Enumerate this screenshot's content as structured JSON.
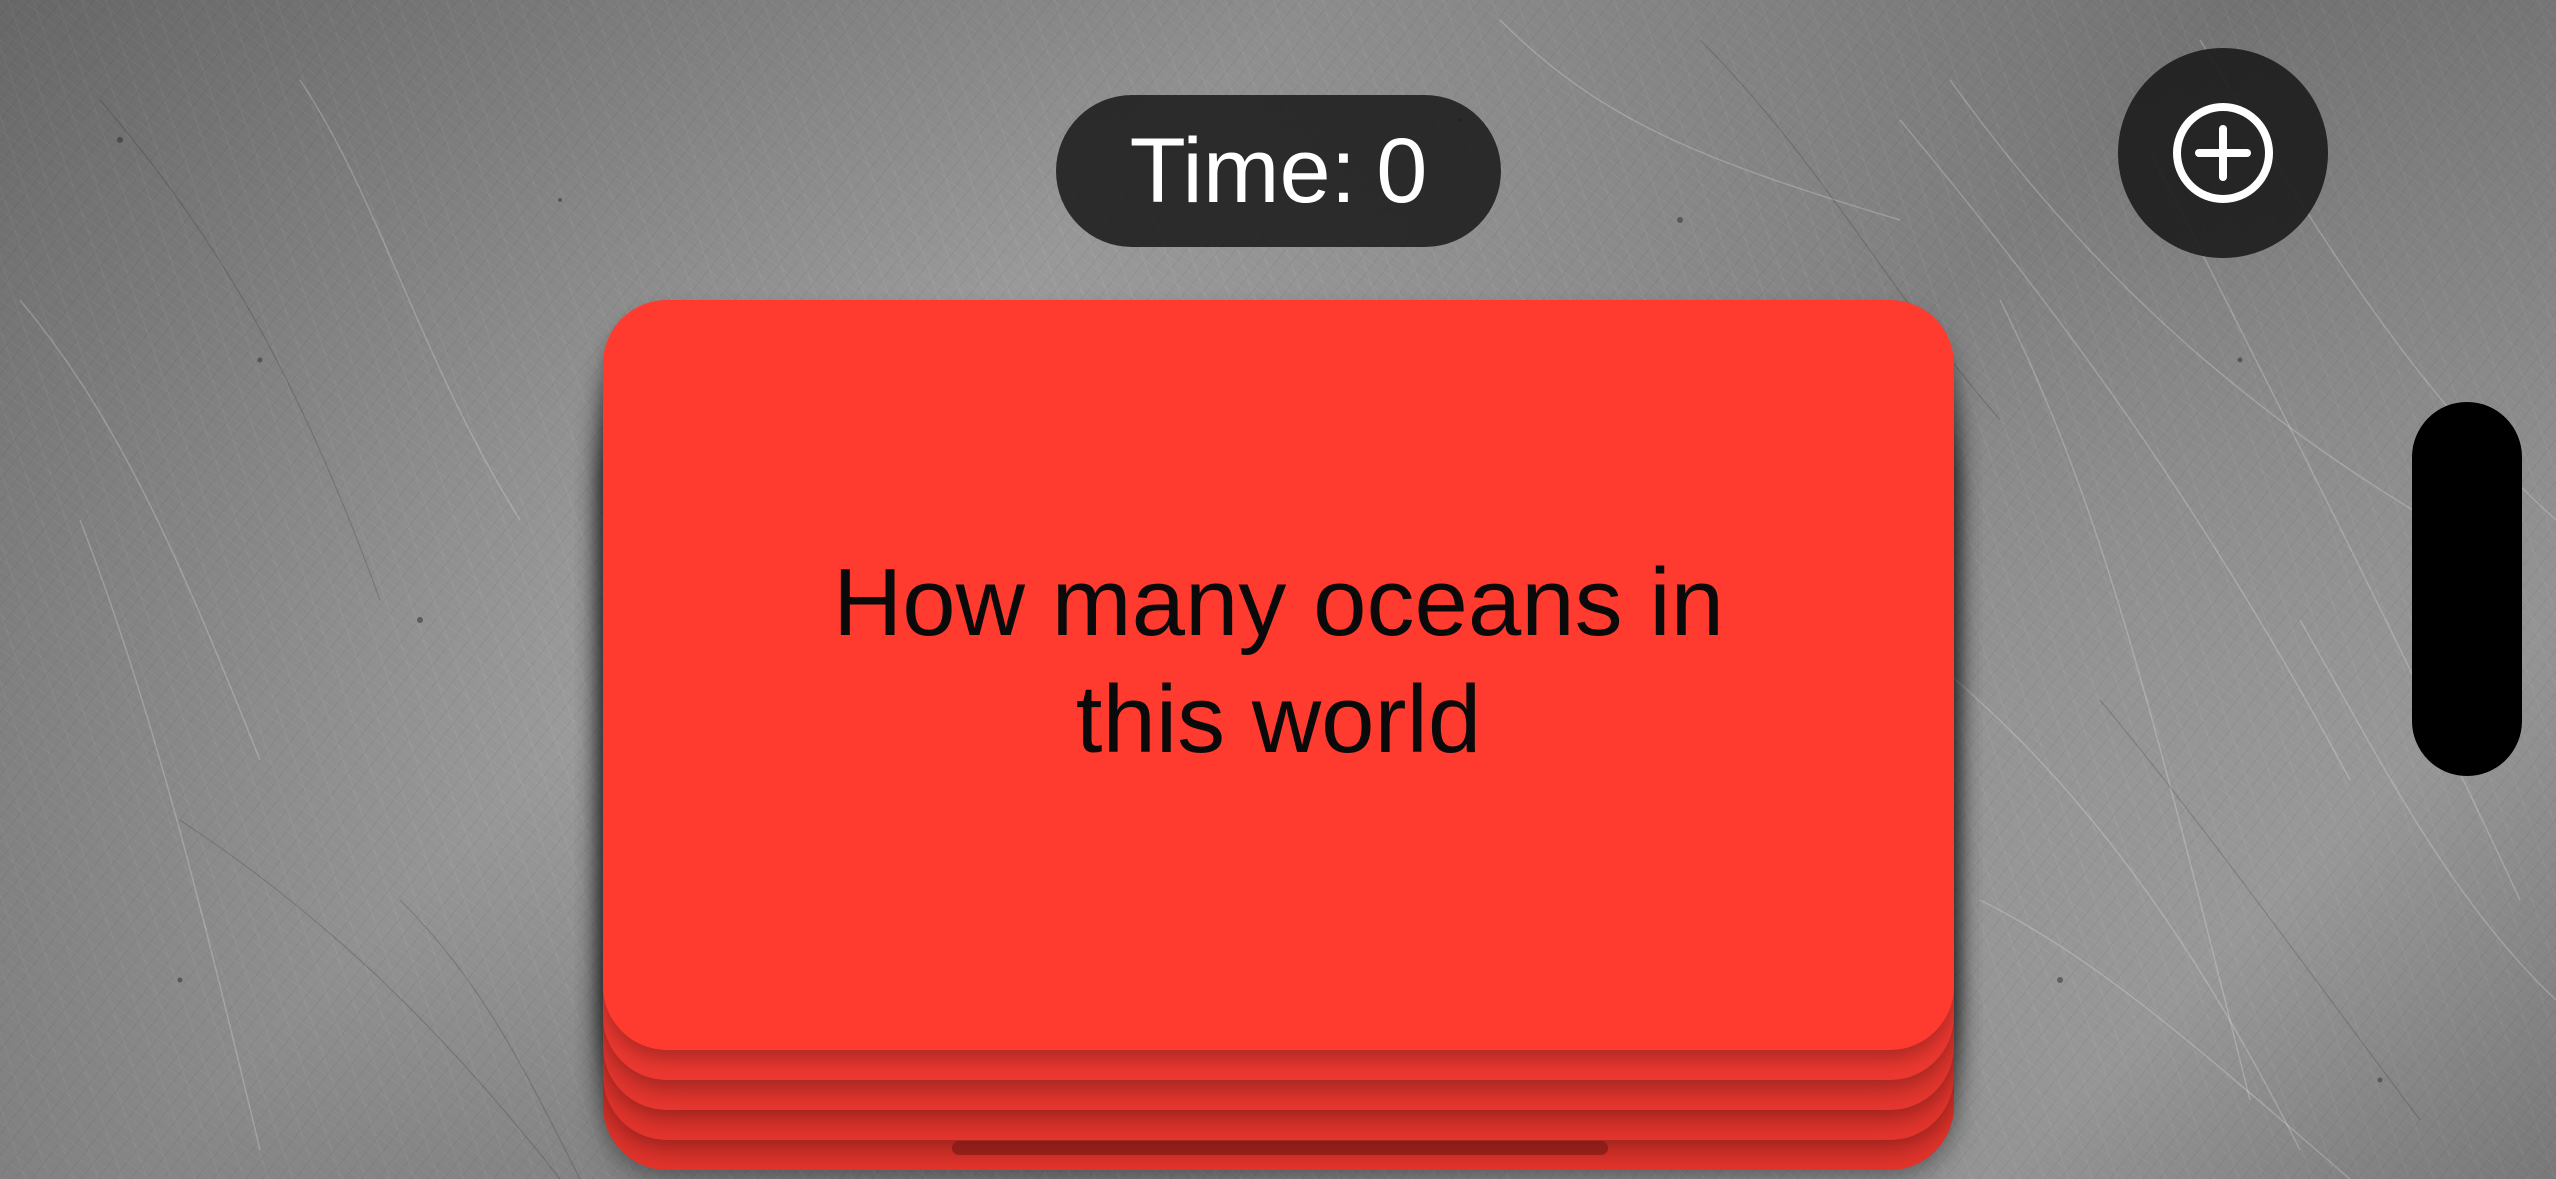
{
  "timer": {
    "label": "Time:",
    "value": "0"
  },
  "toolbar": {
    "add_icon": "plus-circle-icon"
  },
  "card": {
    "question": "How many oceans in this world",
    "color": "#ff3b30"
  },
  "colors": {
    "pill_background": "#1c1c1c",
    "card_red": "#ff3b30",
    "text_white": "#ffffff",
    "text_black": "#0a0a0a"
  }
}
